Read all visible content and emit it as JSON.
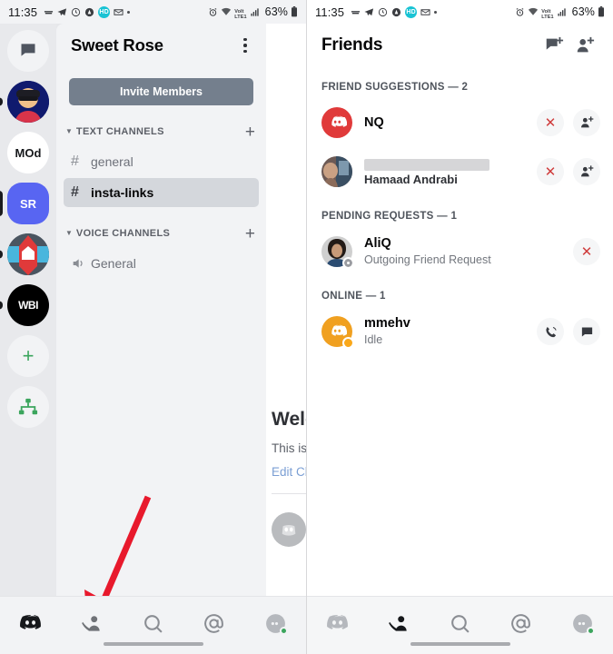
{
  "status_bar": {
    "time": "11:35",
    "left_icons": [
      "keyboard-icon",
      "telegram-icon",
      "clock-icon",
      "adobe-icon",
      "badge-icon",
      "mail-icon",
      "dot-icon"
    ],
    "badge_text": "HD",
    "right_icons": [
      "alarm-icon",
      "wifi-icon",
      "volte-icon",
      "signal-icon"
    ],
    "volte_top": "Volt",
    "volte_bottom": "LTE1",
    "battery_percent": "63%"
  },
  "left_screen": {
    "server_rail": {
      "items": [
        {
          "name": "direct-messages",
          "label": "",
          "type": "dm",
          "color": "#f2f3f5",
          "pill": "none"
        },
        {
          "name": "server-avatar-photo",
          "label": "",
          "type": "photo-blue",
          "color": "#101a6e",
          "pill": "small"
        },
        {
          "name": "server-mod",
          "label": "MOd",
          "type": "text",
          "color": "#ffffff",
          "text_color": "#16181b",
          "pill": "none"
        },
        {
          "name": "server-sr",
          "label": "SR",
          "type": "text",
          "color": "#5865f2",
          "text_color": "#ffffff",
          "pill": "tall"
        },
        {
          "name": "server-home",
          "label": "",
          "type": "photo-home",
          "color": "#4a5560",
          "pill": "small"
        },
        {
          "name": "server-wbi",
          "label": "WBI",
          "type": "text",
          "color": "#000000",
          "text_color": "#ffffff",
          "pill": "small"
        },
        {
          "name": "add-server",
          "label": "+",
          "type": "action",
          "color": "#f2f3f5",
          "text_color": "#3ba55d",
          "pill": "none"
        },
        {
          "name": "explore-servers",
          "label": "",
          "type": "explore",
          "color": "#f2f3f5",
          "text_color": "#3ba55d",
          "pill": "none"
        }
      ]
    },
    "server_title": "Sweet Rose",
    "invite_button": "Invite Members",
    "categories": [
      {
        "label": "TEXT CHANNELS",
        "channels": [
          {
            "name": "general",
            "glyph": "#",
            "active": false
          },
          {
            "name": "insta-links",
            "glyph": "#",
            "active": true
          }
        ]
      },
      {
        "label": "VOICE CHANNELS",
        "channels": [
          {
            "name": "General",
            "glyph": "speaker",
            "active": false
          }
        ]
      }
    ],
    "content_peek": {
      "welcome": "Welcome to #insta-links!",
      "subtitle": "This is the start of the #insta-links channel.",
      "link": "Edit Channel"
    }
  },
  "right_screen": {
    "header": {
      "title": "Friends",
      "new_dm_icon": "new-message-icon",
      "add_friend_icon": "add-friend-icon"
    },
    "sections": [
      {
        "label": "FRIEND SUGGESTIONS — 2",
        "rows": [
          {
            "name": "NQ",
            "subtitle": "",
            "redacted": false,
            "avatar": "discord-red",
            "status": "none",
            "actions": [
              "dismiss-icon",
              "add-friend-icon"
            ]
          },
          {
            "name": "",
            "subtitle": "Hamaad Andrabi",
            "redacted": true,
            "avatar": "photo-person",
            "status": "none",
            "actions": [
              "dismiss-icon",
              "add-friend-icon"
            ]
          }
        ]
      },
      {
        "label": "PENDING REQUESTS — 1",
        "rows": [
          {
            "name": "AliQ",
            "subtitle": "Outgoing Friend Request",
            "redacted": false,
            "avatar": "photo-dark",
            "status": "offline",
            "actions": [
              "dismiss-icon"
            ]
          }
        ]
      },
      {
        "label": "ONLINE — 1",
        "rows": [
          {
            "name": "mmehv",
            "subtitle": "Idle",
            "redacted": false,
            "avatar": "discord-orange",
            "status": "idle",
            "actions": [
              "call-icon",
              "message-icon"
            ]
          }
        ]
      }
    ]
  },
  "bottom_nav": {
    "left": {
      "items": [
        "servers-icon",
        "friends-icon",
        "search-icon",
        "mentions-icon",
        "profile-icon"
      ],
      "active": "friends-icon"
    },
    "right": {
      "items": [
        "servers-icon",
        "friends-icon",
        "search-icon",
        "mentions-icon",
        "profile-icon"
      ],
      "active": "friends-icon"
    }
  },
  "annotation": {
    "arrow_color": "#e8192c",
    "arrow_target": "friends-tab"
  }
}
